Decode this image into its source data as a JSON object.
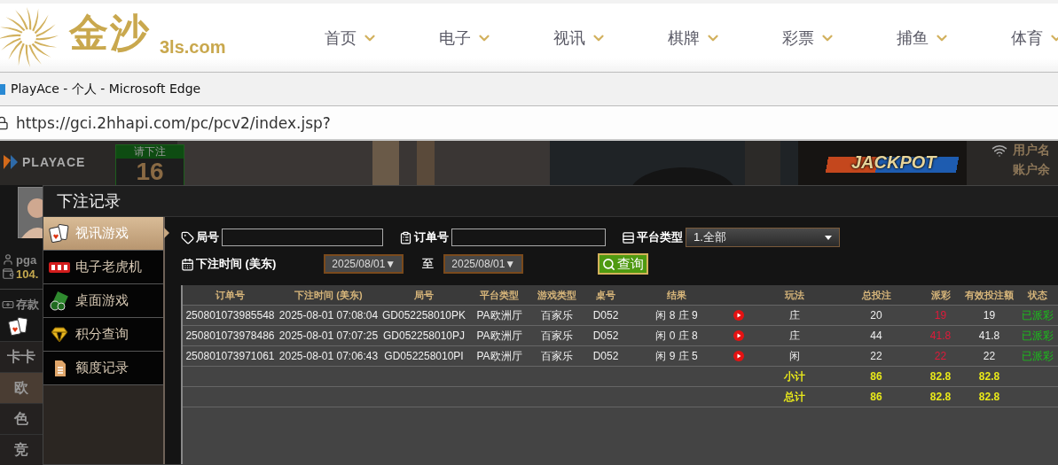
{
  "site_header": {
    "logo_text": "金沙",
    "logo_domain": "3ls.com",
    "nav": [
      {
        "label": "首页"
      },
      {
        "label": "电子"
      },
      {
        "label": "视讯"
      },
      {
        "label": "棋牌"
      },
      {
        "label": "彩票"
      },
      {
        "label": "捕鱼"
      },
      {
        "label": "体育"
      }
    ]
  },
  "browser": {
    "title": "PlayAce - 个人 - Microsoft Edge",
    "url": "https://gci.2hhapi.com/pc/pcv2/index.jsp?"
  },
  "game": {
    "logo": "PLAYACE",
    "bet_prompt": "请下注",
    "countdown": "16",
    "jackpot_label": "JACKPOT",
    "info_labels": [
      "用户名",
      "账户余"
    ],
    "player": {
      "name": "pga",
      "balance": "104.",
      "deposit": "存款"
    },
    "menu": [
      {
        "label": "卡卡",
        "selected": false
      },
      {
        "label": "欧",
        "selected": true
      },
      {
        "label": "色",
        "selected": false
      },
      {
        "label": "竞",
        "selected": false
      }
    ]
  },
  "dialog": {
    "title": "下注记录",
    "sidebar": [
      {
        "label": "视讯游戏",
        "kind": "cards",
        "selected": true
      },
      {
        "label": "电子老虎机",
        "kind": "slots",
        "selected": false
      },
      {
        "label": "桌面游戏",
        "kind": "chips",
        "selected": false
      },
      {
        "label": "积分查询",
        "kind": "diamond",
        "selected": false
      },
      {
        "label": "额度记录",
        "kind": "document",
        "selected": false
      }
    ],
    "filters": {
      "round_label": "局号",
      "order_label": "订单号",
      "platform_label": "平台类型",
      "platform_value": "1.全部",
      "time_label": "下注时间 (美东)",
      "date_from": "2025/08/01▼",
      "to_label": "至",
      "date_to": "2025/08/01▼",
      "query_button": "查询"
    },
    "table": {
      "columns": [
        "订单号",
        "下注时间 (美东)",
        "局号",
        "平台类型",
        "游戏类型",
        "桌号",
        "结果",
        "玩法",
        "总投注",
        "派彩",
        "有效投注额",
        "状态"
      ],
      "rows": [
        {
          "order": "250801073985548",
          "time": "2025-08-01 07:08:04",
          "round": "GD052258010PK",
          "platform": "PA欧洲厅",
          "game": "百家乐",
          "table": "D052",
          "result": "闲 8 庄 9",
          "bet_on": "庄",
          "total": "20",
          "payout": "19",
          "valid": "19",
          "status": "已派彩"
        },
        {
          "order": "250801073978486",
          "time": "2025-08-01 07:07:25",
          "round": "GD052258010PJ",
          "platform": "PA欧洲厅",
          "game": "百家乐",
          "table": "D052",
          "result": "闲 0 庄 8",
          "bet_on": "庄",
          "total": "44",
          "payout": "41.8",
          "valid": "41.8",
          "status": "已派彩"
        },
        {
          "order": "250801073971061",
          "time": "2025-08-01 07:06:43",
          "round": "GD052258010PI",
          "platform": "PA欧洲厅",
          "game": "百家乐",
          "table": "D052",
          "result": "闲 9 庄 5",
          "bet_on": "闲",
          "total": "22",
          "payout": "22",
          "valid": "22",
          "status": "已派彩"
        }
      ],
      "summary_rows": [
        {
          "label": "小计",
          "total": "86",
          "payout": "82.8",
          "valid": "82.8"
        },
        {
          "label": "总计",
          "total": "86",
          "payout": "82.8",
          "valid": "82.8"
        }
      ]
    }
  }
}
